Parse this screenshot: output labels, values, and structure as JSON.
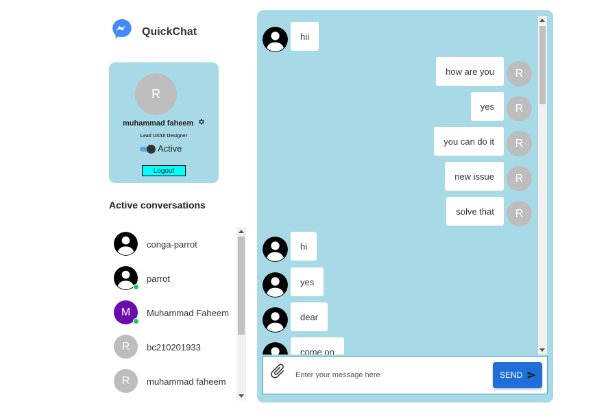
{
  "app": {
    "name": "QuickChat",
    "logo_icon": "messenger-icon",
    "accent": "#448aff"
  },
  "profile": {
    "avatar_letter": "R",
    "name": "muhammad faheem",
    "settings_icon": "gear-icon",
    "role": "Lead UX/UI Designer",
    "status_label": "Active",
    "status_on": true,
    "logout_label": "Logout"
  },
  "conversations": {
    "title": "Active conversations",
    "items": [
      {
        "name": "conga-parrot",
        "avatar": "person-icon",
        "online": false
      },
      {
        "name": "parrot",
        "avatar": "person-icon",
        "online": true
      },
      {
        "name": "Muhammad Faheem",
        "avatar_letter": "M",
        "avatar_color": "#6a0dad",
        "online": true
      },
      {
        "name": "bc210201933",
        "avatar_letter": "R",
        "avatar_color": "#bdbdbd",
        "online": false
      },
      {
        "name": "muhammad faheem",
        "avatar_letter": "R",
        "avatar_color": "#bdbdbd",
        "online": false
      }
    ]
  },
  "chat": {
    "messages": [
      {
        "text": "hii",
        "side": "left"
      },
      {
        "text": "how are you",
        "side": "right",
        "avatar_letter": "R"
      },
      {
        "text": "yes",
        "side": "right",
        "avatar_letter": "R"
      },
      {
        "text": "you can do it",
        "side": "right",
        "avatar_letter": "R"
      },
      {
        "text": "new issue",
        "side": "right",
        "avatar_letter": "R"
      },
      {
        "text": "solve that",
        "side": "right",
        "avatar_letter": "R"
      },
      {
        "text": "hi",
        "side": "left"
      },
      {
        "text": "yes",
        "side": "left"
      },
      {
        "text": "dear",
        "side": "left"
      },
      {
        "text": "come on",
        "side": "left"
      }
    ],
    "composer": {
      "placeholder": "Enter your message here",
      "value": "",
      "attach_icon": "paperclip-icon",
      "send_label": "SEND",
      "send_icon": "send-icon"
    }
  }
}
